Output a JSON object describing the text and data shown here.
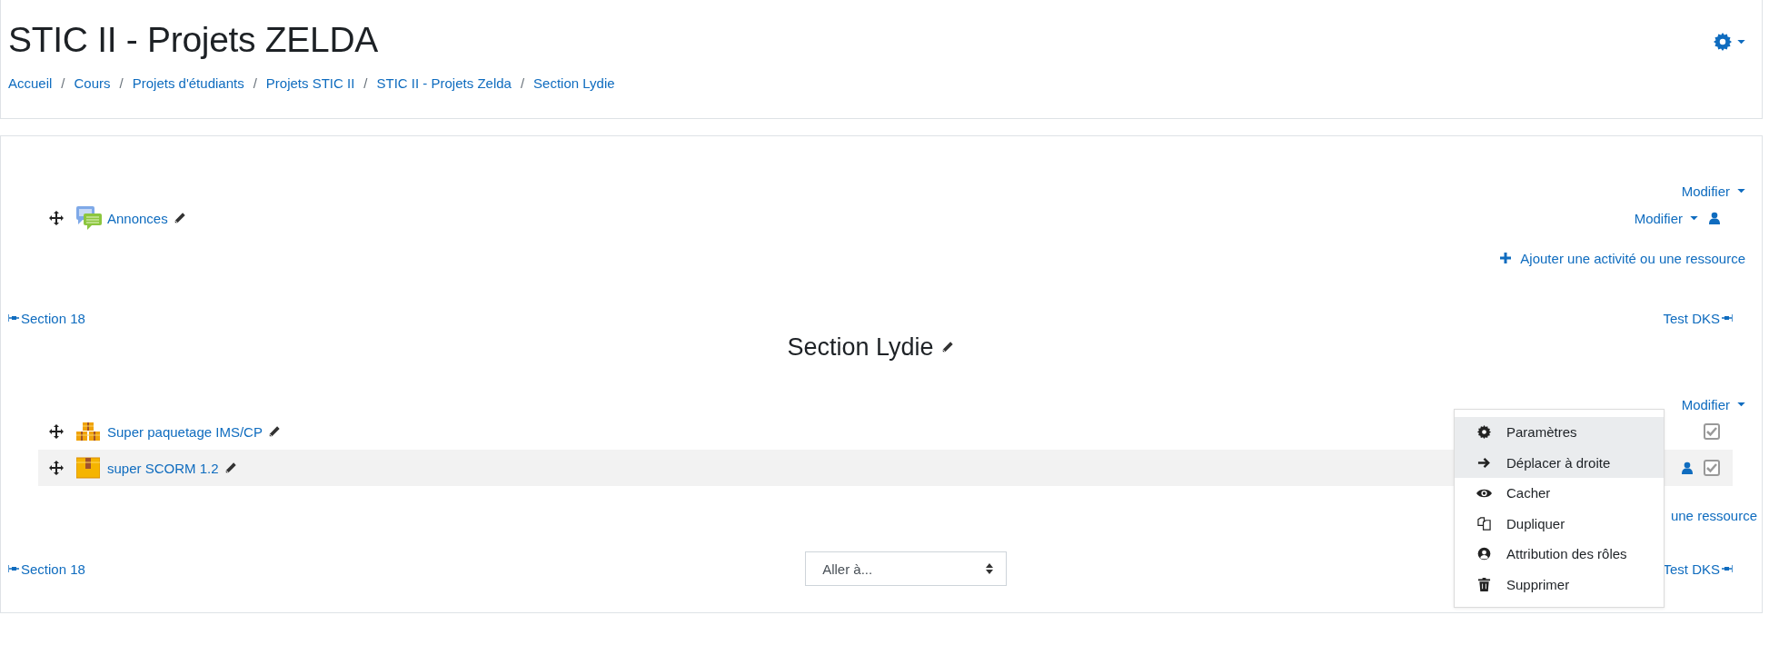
{
  "page_title": "STIC II - Projets ZELDA",
  "breadcrumb": [
    {
      "label": "Accueil"
    },
    {
      "separator": "/",
      "label": "Cours"
    },
    {
      "separator": "/",
      "label": "Projets d'étudiants"
    },
    {
      "separator": "/",
      "label": "Projets STIC II"
    },
    {
      "separator": "/",
      "label": "STIC II - Projets Zelda"
    },
    {
      "separator": "/",
      "label": "Section Lydie"
    }
  ],
  "sections": [
    {
      "edit_label": "Modifier",
      "activities": [
        {
          "kind": "forum",
          "name": "Annonces",
          "edit_label": "Modifier",
          "highlighted": false,
          "group_icon": true
        }
      ],
      "add_label": "Ajouter une activité ou une ressource",
      "add_icon_visible": true
    },
    {
      "nav_prev": "Section 18",
      "nav_next": "Test DKS",
      "title": "Section Lydie",
      "edit_label": "Modifier",
      "activities": [
        {
          "kind": "package",
          "name": "Super paquetage IMS/CP",
          "highlighted": false,
          "group_icon": false,
          "checked": true
        },
        {
          "kind": "scorm",
          "name": "super SCORM 1.2",
          "highlighted": true,
          "group_icon": true,
          "checked": true
        }
      ],
      "add_label": "une ressource",
      "add_icon_visible": false
    }
  ],
  "bottom_nav": {
    "prev": "Section 18",
    "jump": "Aller à...",
    "next": "Test DKS"
  },
  "menu": [
    {
      "kind": "gear",
      "label": "Paramètres",
      "highlighted": true
    },
    {
      "kind": "arrow",
      "label": "Déplacer à droite",
      "highlighted": true
    },
    {
      "kind": "eye",
      "label": "Cacher",
      "highlighted": false
    },
    {
      "kind": "copy",
      "label": "Dupliquer",
      "highlighted": false
    },
    {
      "kind": "user",
      "label": "Attribution des rôles",
      "highlighted": false
    },
    {
      "kind": "trash",
      "label": "Supprimer",
      "highlighted": false
    }
  ]
}
